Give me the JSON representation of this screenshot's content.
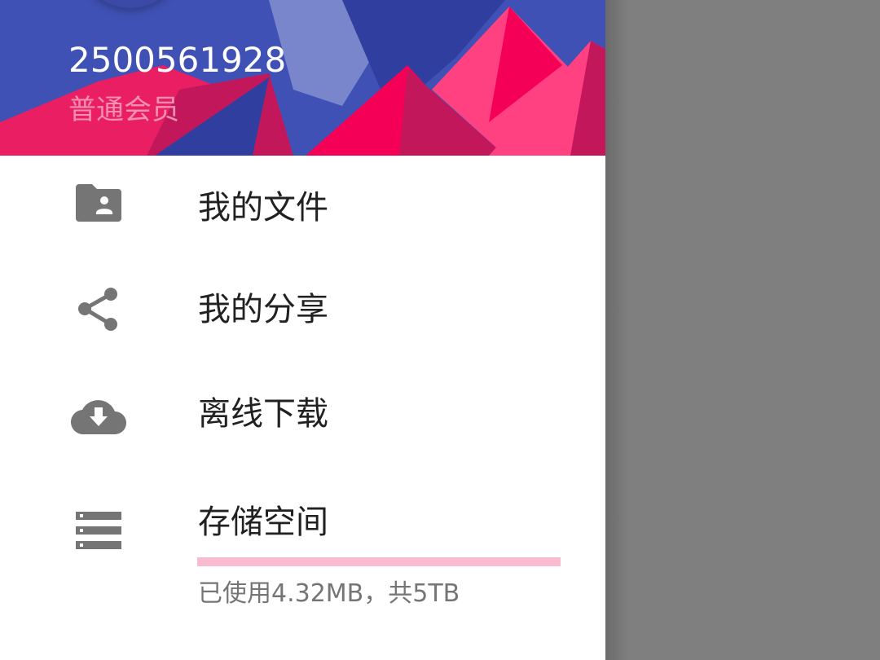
{
  "header": {
    "user_id": "2500561928",
    "membership": "普通会员"
  },
  "menu": {
    "items": [
      {
        "label": "我的文件",
        "icon": "folder-shared-icon"
      },
      {
        "label": "我的分享",
        "icon": "share-icon"
      },
      {
        "label": "离线下载",
        "icon": "cloud-download-icon"
      },
      {
        "label": "存储空间",
        "icon": "storage-icon"
      }
    ]
  },
  "storage": {
    "usage_text": "已使用4.32MB，共5TB",
    "used_fraction": 1e-06
  },
  "colors": {
    "header_blue": "#3f51b5",
    "accent_pink": "#f48fb1",
    "icon_gray": "#757575",
    "scrim": "#7f7f7f"
  }
}
